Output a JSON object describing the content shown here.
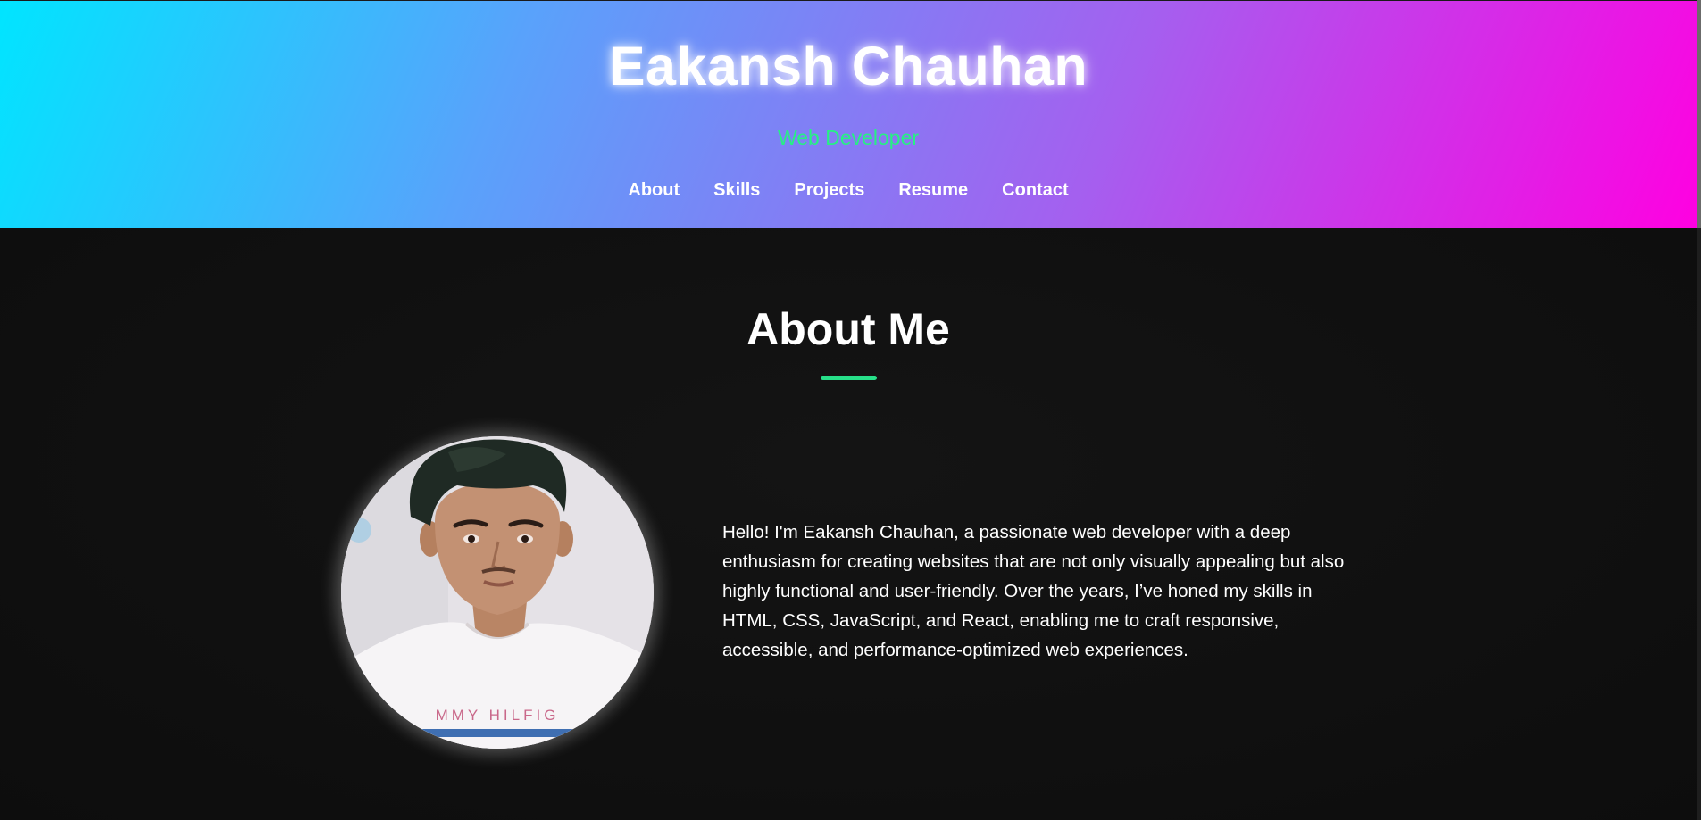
{
  "header": {
    "title": "Eakansh Chauhan",
    "subtitle": "Web Developer",
    "nav": [
      {
        "label": "About"
      },
      {
        "label": "Skills"
      },
      {
        "label": "Projects"
      },
      {
        "label": "Resume"
      },
      {
        "label": "Contact"
      }
    ]
  },
  "about": {
    "heading": "About Me",
    "bio": "Hello! I'm Eakansh Chauhan, a passionate web developer with a deep enthusiasm for creating websites that are not only visually appealing but also highly functional and user-friendly. Over the years, I’ve honed my skills in HTML, CSS, JavaScript, and React, enabling me to craft responsive, accessible, and performance-optimized web experiences.",
    "photo_shirt_text": "MMY HILFIG"
  },
  "colors": {
    "gradient_start": "#00e5ff",
    "gradient_end": "#ff00e1",
    "accent_green": "#27f084",
    "background": "#0f0f10"
  }
}
